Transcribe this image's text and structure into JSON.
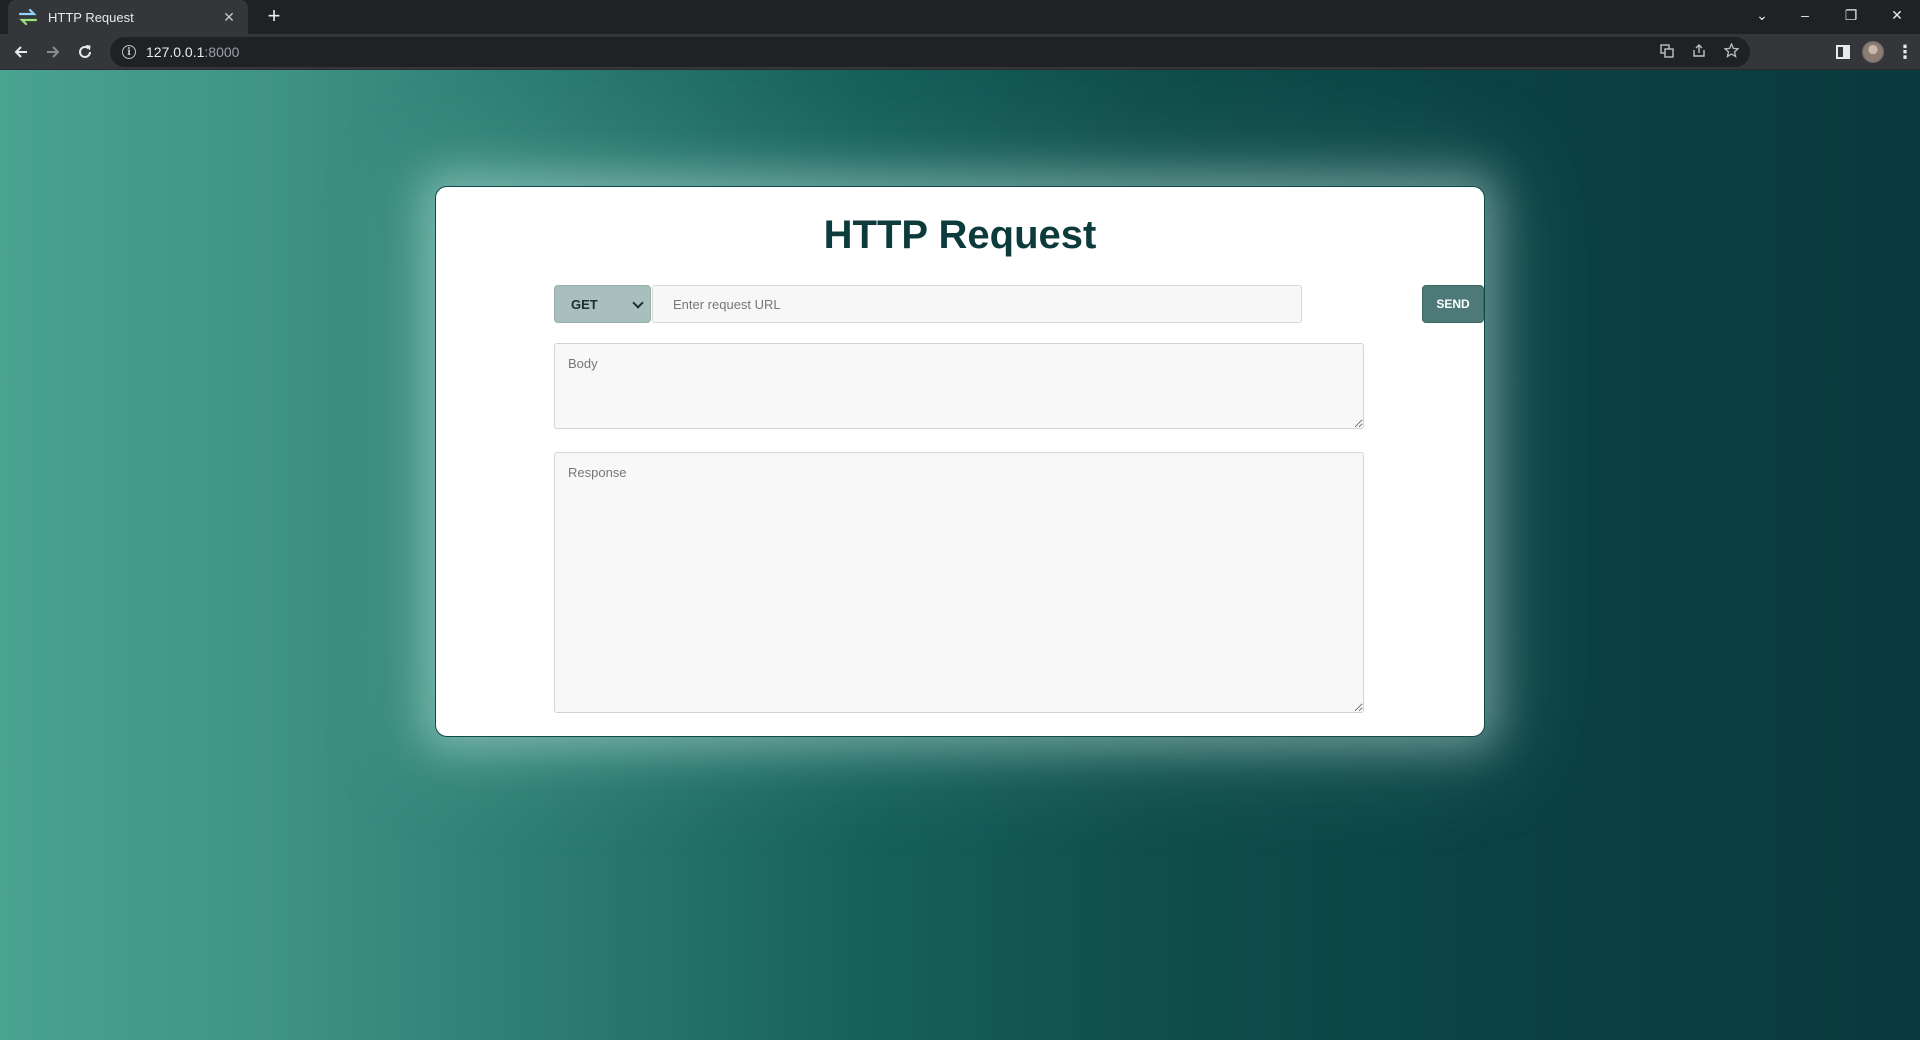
{
  "browser": {
    "tab_title": "HTTP Request",
    "tab_close": "✕",
    "new_tab": "+",
    "url_host": "127.0.0.1",
    "url_port": ":8000",
    "window_controls": {
      "tab_search": "⌄",
      "minimize": "–",
      "restore": "❐",
      "close": "✕"
    }
  },
  "page": {
    "title": "HTTP Request",
    "method": {
      "selected": "GET"
    },
    "url": {
      "placeholder": "Enter request URL",
      "value": ""
    },
    "send_label": "SEND",
    "body": {
      "placeholder": "Body"
    },
    "response": {
      "placeholder": "Response"
    }
  },
  "colors": {
    "gradient_left": "#4aa291",
    "gradient_right": "#093a3d",
    "title": "#0d3b3c",
    "send_button": "#4d7a78",
    "method_select": "#a9bfbe"
  }
}
